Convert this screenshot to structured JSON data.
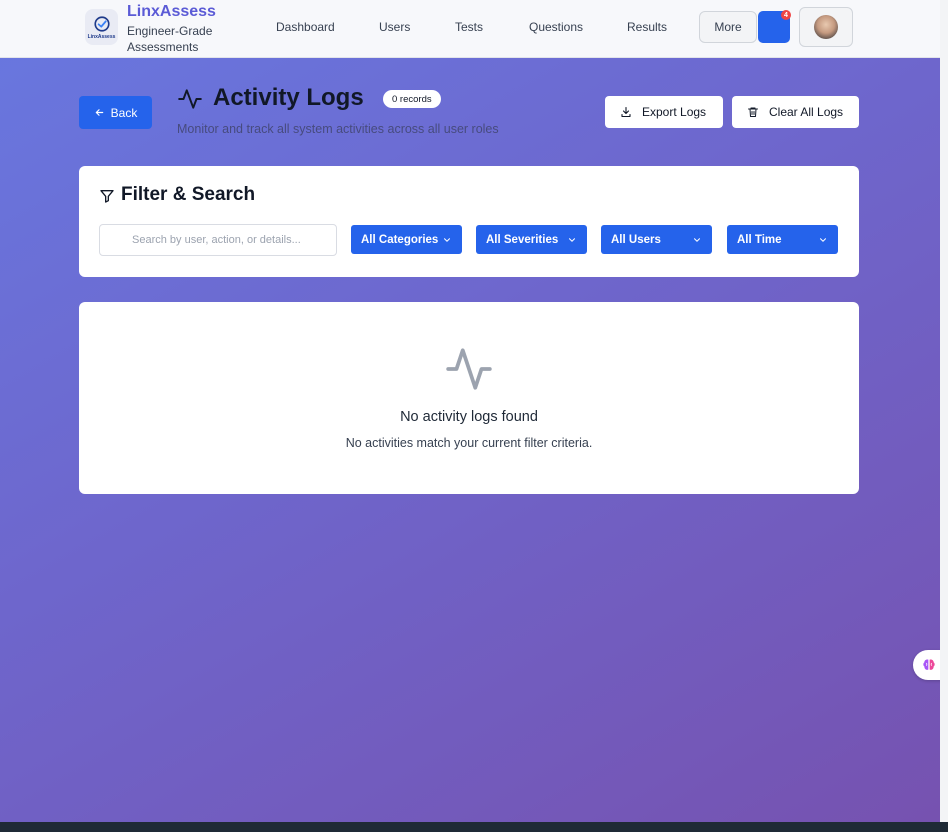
{
  "navbar": {
    "brand": "LinxAssess",
    "tagline": "Engineer-Grade Assessments",
    "logo_text": "LinxAssess",
    "links": [
      "Dashboard",
      "Users",
      "Tests",
      "Questions",
      "Results"
    ],
    "more_label": "More",
    "notification_count": "4"
  },
  "header": {
    "back_label": "Back",
    "title": "Activity Logs",
    "records_badge": "0 records",
    "subtitle": "Monitor and track all system activities across all user roles",
    "export_label": "Export Logs",
    "clear_label": "Clear All Logs"
  },
  "filter": {
    "title": "Filter & Search",
    "search_placeholder": "Search by user, action, or details...",
    "category": "All Categories",
    "severity": "All Severities",
    "user": "All Users",
    "time": "All Time"
  },
  "empty_state": {
    "title": "No activity logs found",
    "description": "No activities match your current filter criteria."
  },
  "colors": {
    "primary": "#2563eb",
    "brand": "#5b5bd6",
    "badge": "#ef4444"
  },
  "icons": [
    "check-circle-logo-icon",
    "arrow-left-icon",
    "activity-pulse-icon",
    "download-icon",
    "trash-icon",
    "filter-funnel-icon",
    "chevron-down-icon",
    "brain-icon"
  ]
}
